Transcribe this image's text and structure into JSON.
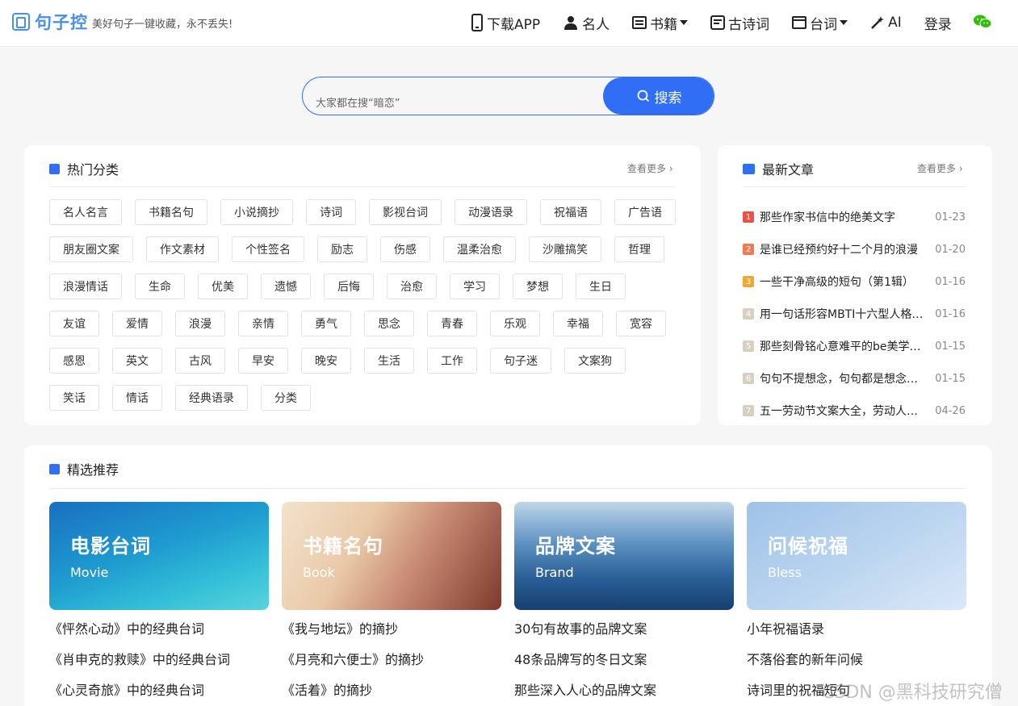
{
  "header": {
    "logo_text": "句子控",
    "slogan": "美好句子一键收藏，永不丢失!",
    "nav": [
      {
        "label": "下载APP",
        "icon": "phone-icon"
      },
      {
        "label": "名人",
        "icon": "person-icon"
      },
      {
        "label": "书籍",
        "icon": "book-icon",
        "dropdown": true
      },
      {
        "label": "古诗词",
        "icon": "document-icon"
      },
      {
        "label": "台词",
        "icon": "film-icon",
        "dropdown": true
      },
      {
        "label": "AI",
        "icon": "magic-wand-icon"
      },
      {
        "label": "登录",
        "icon": null
      }
    ],
    "wechat_icon": "wechat-icon"
  },
  "search": {
    "placeholder": "大家都在搜“暗恋”",
    "button_label": "搜索"
  },
  "hot_categories": {
    "title": "热门分类",
    "more": "查看更多",
    "rows": [
      [
        "名人名言",
        "书籍名句",
        "小说摘抄",
        "诗词",
        "影视台词",
        "动漫语录",
        "祝福语",
        "广告语"
      ],
      [
        "朋友圈文案",
        "作文素材",
        "个性签名",
        "励志",
        "伤感",
        "温柔治愈",
        "沙雕搞笑",
        "哲理"
      ],
      [
        "浪漫情话",
        "生命",
        "优美",
        "遗憾",
        "后悔",
        "治愈",
        "学习",
        "梦想",
        "生日"
      ],
      [
        "友谊",
        "爱情",
        "浪漫",
        "亲情",
        "勇气",
        "思念",
        "青春",
        "乐观",
        "幸福",
        "宽容"
      ],
      [
        "感恩",
        "英文",
        "古风",
        "早安",
        "晚安",
        "生活",
        "工作",
        "句子迷",
        "文案狗"
      ],
      [
        "笑话",
        "情话",
        "经典语录",
        "分类"
      ]
    ]
  },
  "latest_articles": {
    "title": "最新文章",
    "more": "查看更多",
    "items": [
      {
        "num": "1",
        "title": "那些作家书信中的绝美文字",
        "date": "01-23"
      },
      {
        "num": "2",
        "title": "是谁已经预约好十二个月的浪漫",
        "date": "01-20"
      },
      {
        "num": "3",
        "title": "一些干净高级的短句（第1辑）",
        "date": "01-16"
      },
      {
        "num": "4",
        "title": "用一句话形容MBTI十六型人格性格",
        "date": "01-16"
      },
      {
        "num": "5",
        "title": "那些刻骨铭心意难平的be美学句子",
        "date": "01-15"
      },
      {
        "num": "6",
        "title": "句句不提想念，句句都是想念一些",
        "date": "01-15"
      },
      {
        "num": "7",
        "title": "五一劳动节文案大全，劳动人民最光荣",
        "date": "04-26"
      }
    ],
    "num_colors": [
      "#e8524a",
      "#ee7a55",
      "#f0a830",
      "#d8cfbf",
      "#d8cfbf",
      "#d8cfbf",
      "#d8cfbf"
    ]
  },
  "featured": {
    "title": "精选推荐",
    "columns": [
      {
        "title": "电影台词",
        "subtitle": "Movie",
        "links": [
          "《怦然心动》中的经典台词",
          "《肖申克的救赎》中的经典台词",
          "《心灵奇旅》中的经典台词"
        ]
      },
      {
        "title": "书籍名句",
        "subtitle": "Book",
        "links": [
          "《我与地坛》的摘抄",
          "《月亮和六便士》的摘抄",
          "《活着》的摘抄"
        ]
      },
      {
        "title": "品牌文案",
        "subtitle": "Brand",
        "links": [
          "30句有故事的品牌文案",
          "48条品牌写的冬日文案",
          "那些深入人心的品牌文案"
        ]
      },
      {
        "title": "问候祝福",
        "subtitle": "Bless",
        "links": [
          "小年祝福语录",
          "不落俗套的新年问候",
          "诗词里的祝福短句"
        ]
      }
    ]
  },
  "watermark": "CSDN @黑科技研究僧",
  "colors": {
    "accent": "#2f6ef5",
    "logo": "#4a90e2",
    "wechat": "#2dc100"
  }
}
